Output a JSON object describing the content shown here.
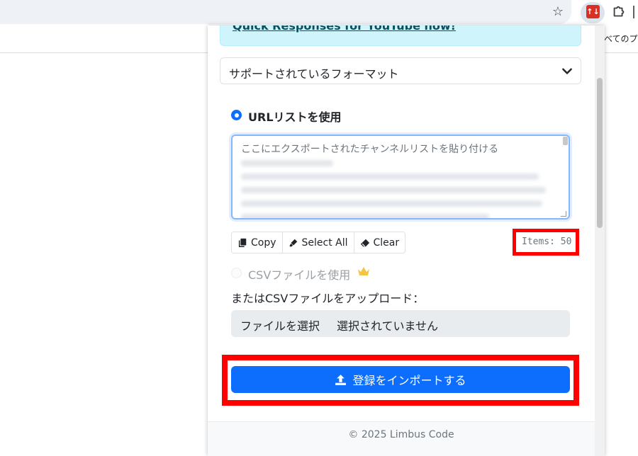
{
  "browser": {
    "page_snippet": "べてのプ",
    "extension_badge": "↑↓",
    "colors": {
      "toolbar": "#eef1f6",
      "extension_red": "#d93025"
    }
  },
  "popup": {
    "promo_link": "Quick Responses for YouTube now!",
    "accordion_label": "サポートされているフォーマット",
    "url_list": {
      "radio_label": "URLリストを使用",
      "selected": true,
      "textarea_placeholder": "ここにエクスポートされたチャンネルリストを貼り付ける"
    },
    "buttons": {
      "copy": "Copy",
      "select_all": "Select All",
      "clear": "Clear"
    },
    "items_count": "Items: 50",
    "csv": {
      "radio_label": "CSVファイルを使用",
      "upload_label": "またはCSVファイルをアップロード：",
      "file_button": "ファイルを選択",
      "file_status": "選択されていません"
    },
    "import_button": "登録をインポートする",
    "footer": "© 2025 Limbus Code",
    "colors": {
      "primary": "#0d6efd",
      "promo_bg": "#cff4fc",
      "highlight": "#ff0000",
      "premium_crown": "#f4c542"
    }
  }
}
